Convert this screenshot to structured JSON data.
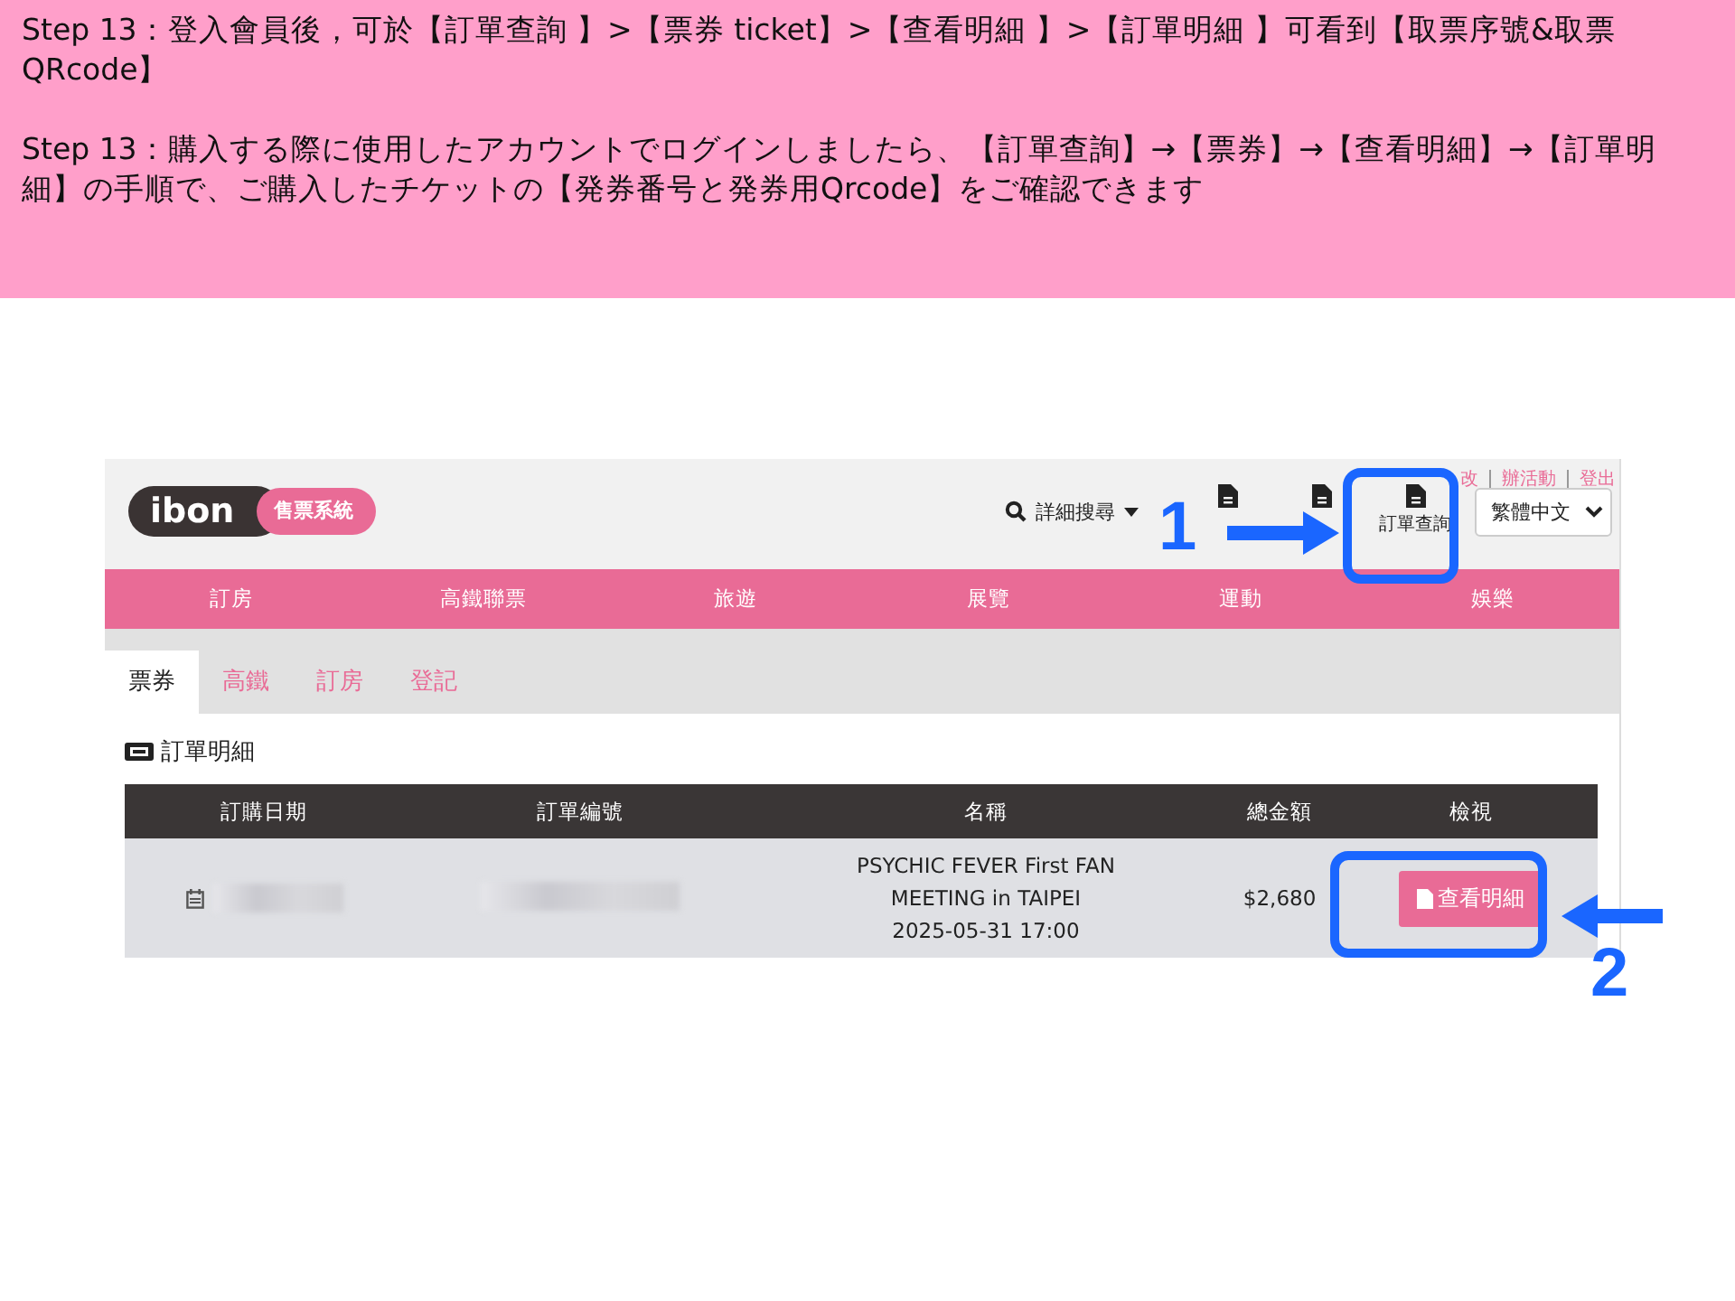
{
  "instructions": [
    "Step 13：登入會員後，可於【訂單查詢 】>【票券 ticket】>【查看明細 】>【訂單明細 】可看到【取票序號&取票QRcode】",
    "Step 13：購入する際に使用したアカウントでログインしましたら、【訂單查詢】→【票券】→【查看明細】→【訂單明細】の手順で、ご購入したチケットの【発券番号と発券用Qrcode】をご確認できます"
  ],
  "site": {
    "logo": "ibon",
    "logo_tag": "售票系統",
    "top_links": [
      "改",
      "辦活動",
      "登出"
    ],
    "search": "詳細搜尋",
    "tools": [
      {
        "kind": "icon"
      },
      {
        "kind": "icon"
      },
      {
        "kind": "labeled",
        "label": "訂單查詢"
      }
    ],
    "language": "繁體中文",
    "nav": [
      "訂房",
      "高鐵聯票",
      "旅遊",
      "展覽",
      "運動",
      "娛樂"
    ],
    "tabs": [
      {
        "label": "票券",
        "selected": true
      },
      {
        "label": "高鐵",
        "selected": false
      },
      {
        "label": "訂房",
        "selected": false
      },
      {
        "label": "登記",
        "selected": false
      }
    ],
    "section_title": "訂單明細",
    "table": {
      "columns": [
        "訂購日期",
        "訂單編號",
        "名稱",
        "總金額",
        "檢視"
      ],
      "rows": [
        {
          "name": [
            "PSYCHIC FEVER First FAN",
            "MEETING in TAIPEI",
            "2025-05-31 17:00"
          ],
          "total": "$2,680",
          "action": "查看明細"
        }
      ]
    }
  },
  "annotations": [
    {
      "number": "1"
    },
    {
      "number": "2"
    }
  ]
}
